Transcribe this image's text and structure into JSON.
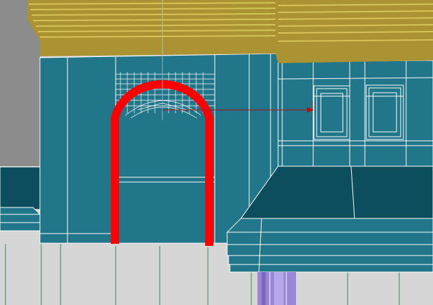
{
  "viewport": {
    "background_color": "#d6d6d6",
    "backdrop_color": "#8c8c8c"
  },
  "scene": {
    "wall_color": "#217689",
    "wall_shadow_color": "#0c4e5e",
    "wire_color": "#ffffff",
    "roof_color": "#ab9233",
    "roof_stripe_color": "#d7c35b",
    "selected_arch_color": "#ff0000",
    "pillar_color": "#9a86d6",
    "ground_line_color": "#2f8a5c",
    "pivot_line_color": "#b01010"
  },
  "icons": [
    "arch-spline-icon",
    "transform-pivot-icon"
  ]
}
